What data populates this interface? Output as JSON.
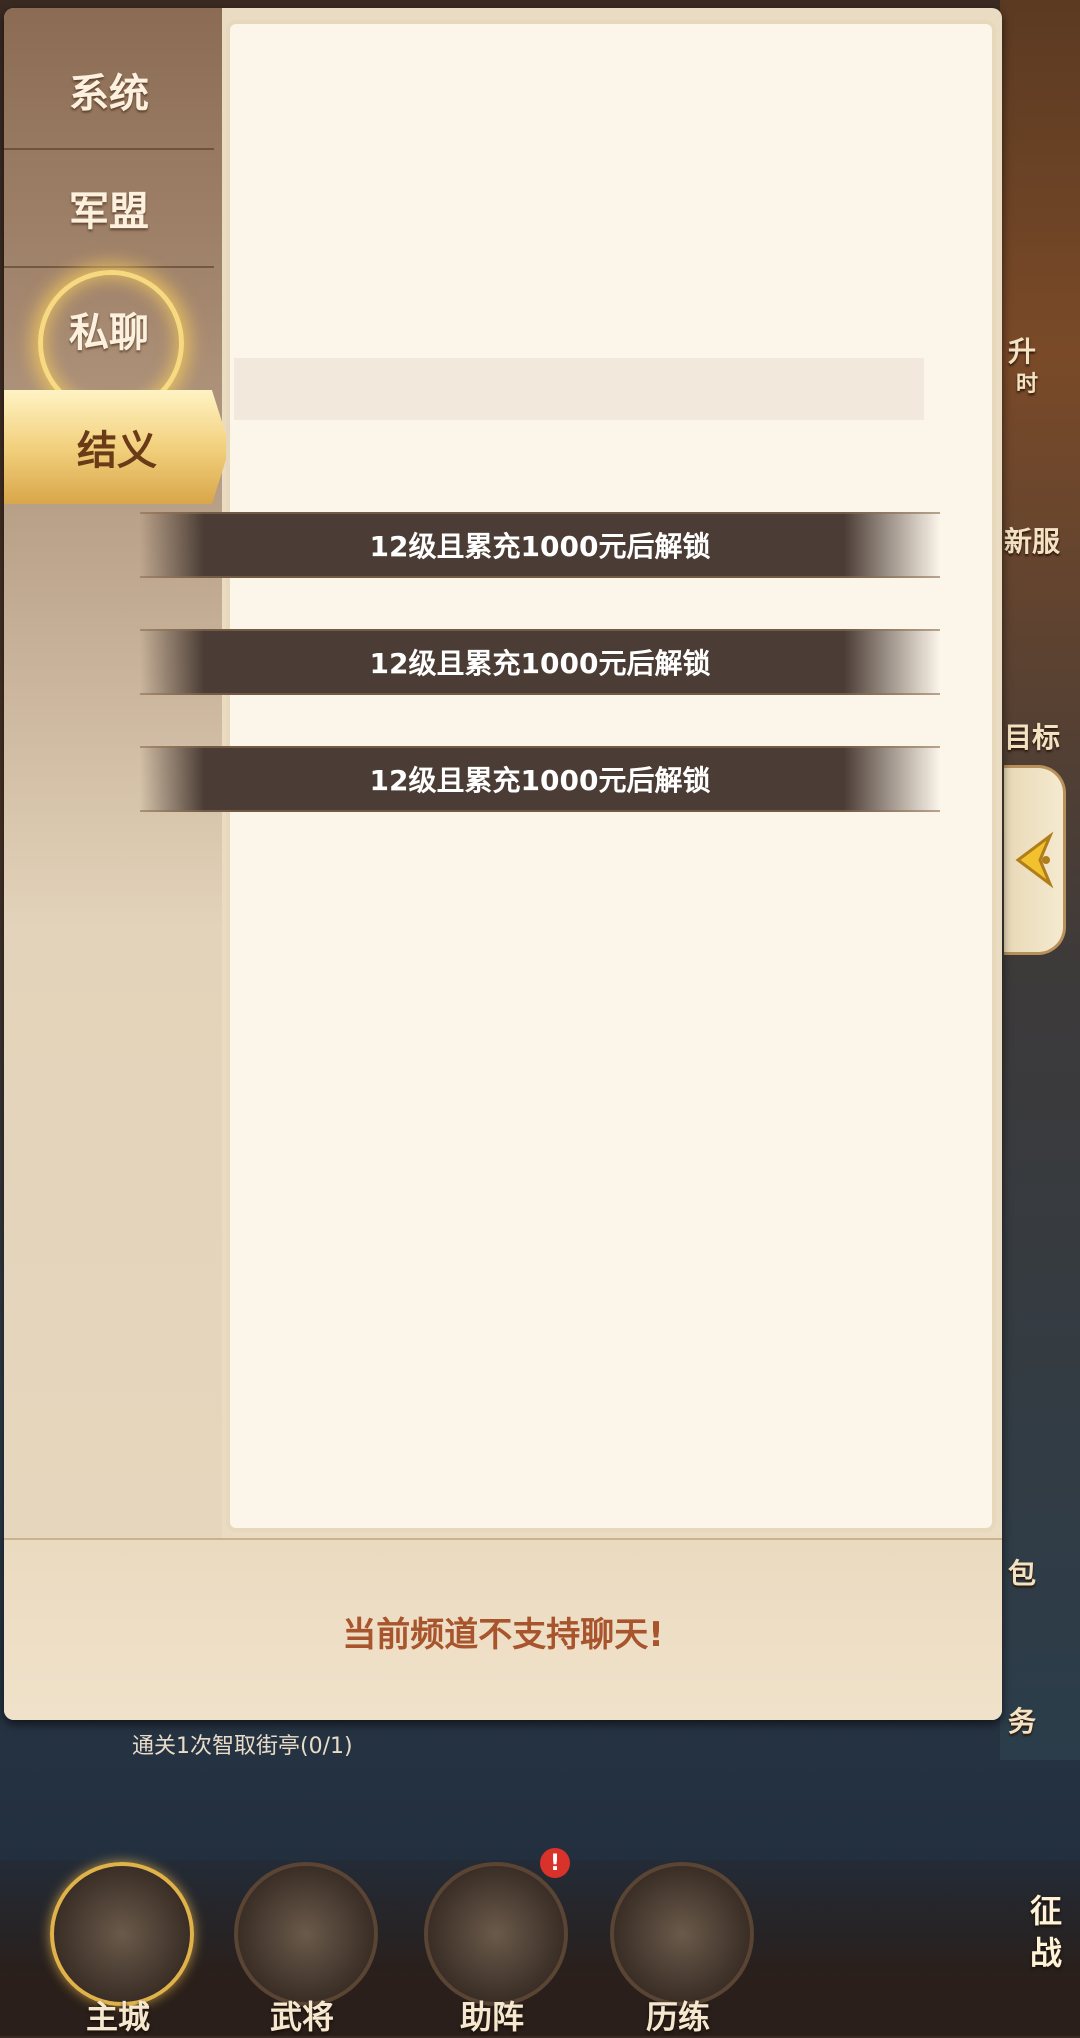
{
  "channel_tabs": [
    {
      "label": "系统"
    },
    {
      "label": "军盟"
    },
    {
      "label": "私聊"
    },
    {
      "label": "结义"
    }
  ],
  "active_tab": "结义",
  "lock_messages": [
    "12级且累充1000元后解锁",
    "12级且累充1000元后解锁",
    "12级且累充1000元后解锁"
  ],
  "footer_notice": "当前频道不支持聊天!",
  "background": {
    "side_labels": [
      "升",
      "时",
      "新服",
      "目标",
      "包",
      "务"
    ],
    "task_text": "通关1次智取街亭(0/1)",
    "bottom_nav": [
      {
        "label": "主城"
      },
      {
        "label": "武将"
      },
      {
        "label": "助阵",
        "badge": "!"
      },
      {
        "label": "历练"
      }
    ],
    "expedition_label": "征战"
  }
}
